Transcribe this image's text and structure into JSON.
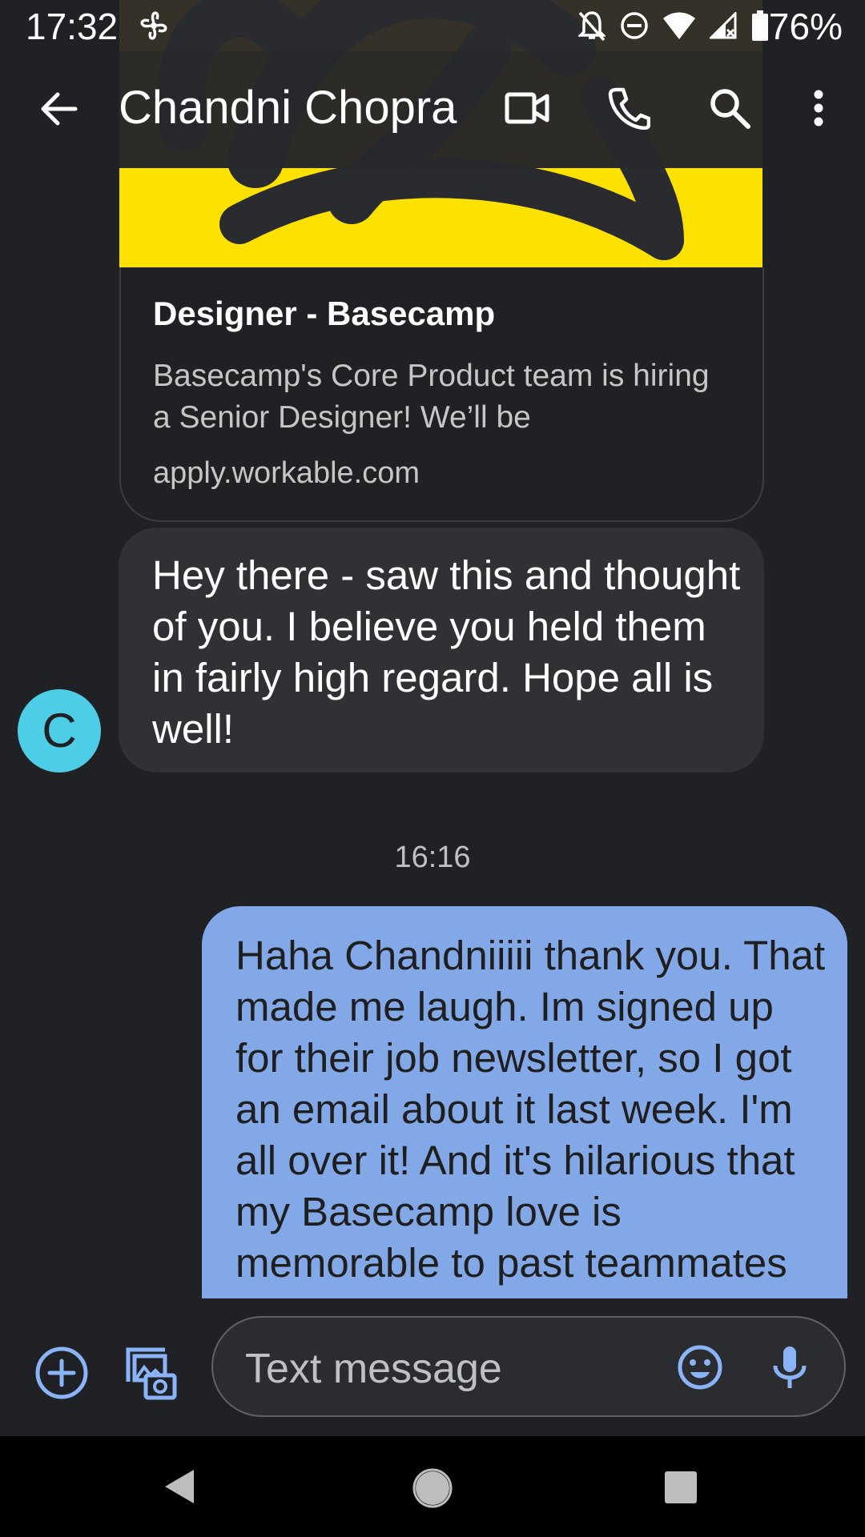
{
  "status_bar": {
    "time": "17:32",
    "battery": "76%",
    "icons": [
      "fan-icon",
      "notifications-off-icon",
      "do-not-disturb-icon",
      "wifi-icon",
      "signal-icon",
      "battery-icon"
    ]
  },
  "header": {
    "contact_name": "Chandni Chopra",
    "actions": [
      "back-arrow-icon",
      "video-call-icon",
      "phone-icon",
      "search-icon",
      "more-vert-icon"
    ]
  },
  "messages": [
    {
      "type": "link_preview",
      "direction": "incoming",
      "title": "Designer - Basecamp",
      "description": "Basecamp's Core Product team is hiring a Senior Designer! We’ll be",
      "domain": "apply.workable.com"
    },
    {
      "type": "text",
      "direction": "incoming",
      "avatar_initial": "C",
      "text": "Hey there - saw this and thought of you. I believe you held them in fairly high regard. Hope all is well!"
    },
    {
      "type": "timestamp",
      "text": "16:16"
    },
    {
      "type": "text",
      "direction": "outgoing",
      "text": "Haha Chandniiiii thank you. That made me laugh. Im signed up for their job newsletter, so I got an email about it last week. I'm all over it! And it's hilarious that my Basecamp love is memorable to past teammates"
    }
  ],
  "compose": {
    "placeholder": "Text message"
  },
  "colors": {
    "background": "#202124",
    "incoming_bubble": "#303134",
    "outgoing_bubble": "#83a8e8",
    "avatar": "#4ecde6",
    "preview_yellow": "#fde100",
    "accent_icon": "#8ab4f8"
  }
}
